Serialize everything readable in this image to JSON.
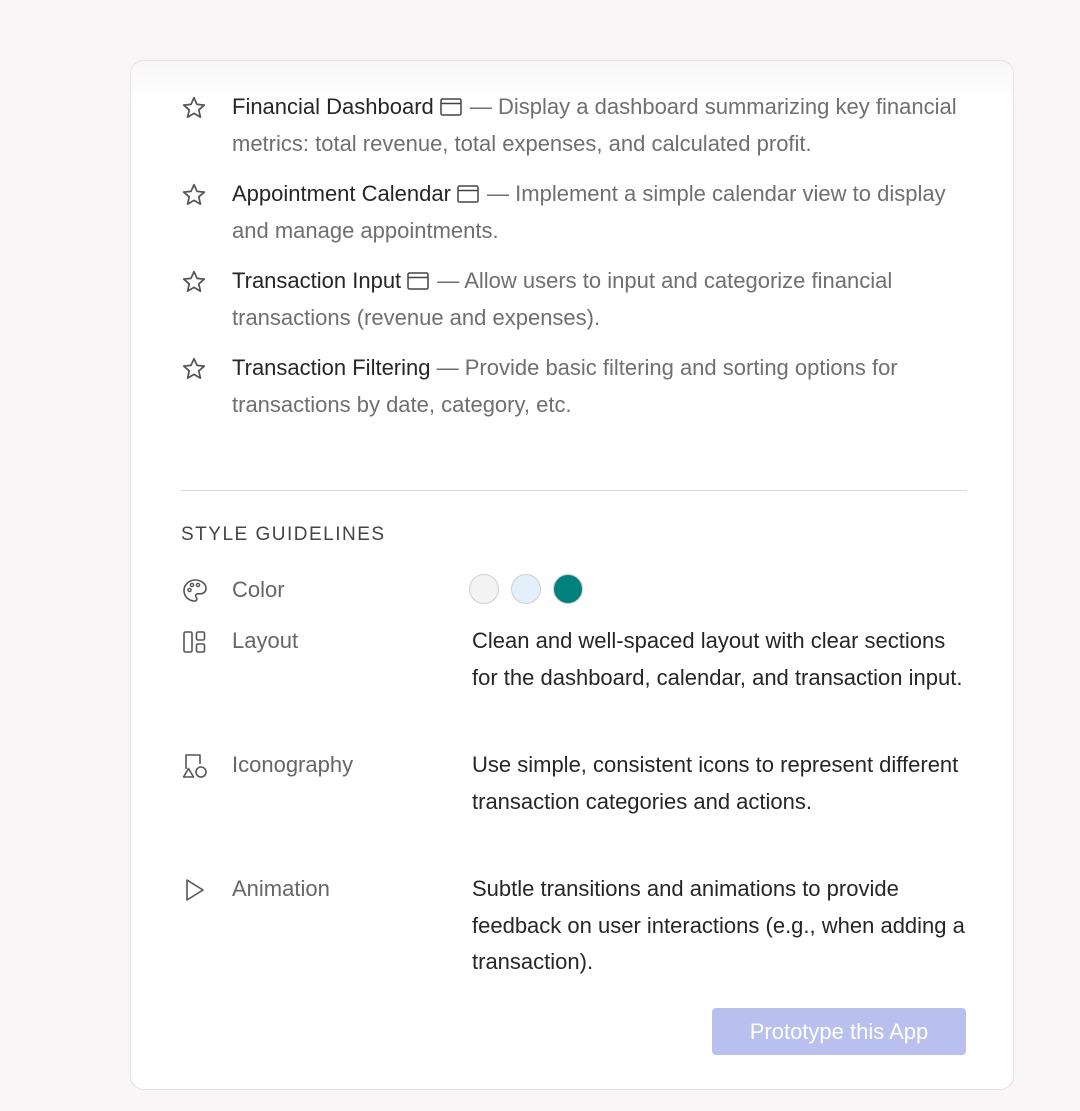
{
  "features": [
    {
      "name": "Financial Dashboard",
      "has_window_icon": true,
      "separator": "—",
      "description": "Display a dashboard summarizing key financial metrics: total revenue, total expenses, and calculated profit."
    },
    {
      "name": "Appointment Calendar",
      "has_window_icon": true,
      "separator": "—",
      "description": "Implement a simple calendar view to display and manage appointments."
    },
    {
      "name": "Transaction Input",
      "has_window_icon": true,
      "separator": "—",
      "description": "Allow users to input and categorize financial transactions (revenue and expenses)."
    },
    {
      "name": "Transaction Filtering",
      "has_window_icon": false,
      "separator": "—",
      "description": "Provide basic filtering and sorting options for transactions by date, category, etc."
    }
  ],
  "style_guidelines": {
    "title": "STYLE GUIDELINES",
    "color": {
      "label": "Color",
      "icon": "palette-icon",
      "swatches": [
        "#f3f3f3",
        "#e3f0fb",
        "#00817e"
      ]
    },
    "layout": {
      "label": "Layout",
      "icon": "layout-icon",
      "description": "Clean and well-spaced layout with clear sections for the dashboard, calendar, and transaction input."
    },
    "iconography": {
      "label": "Iconography",
      "icon": "shapes-icon",
      "description": "Use simple, consistent icons to represent different transaction categories and actions."
    },
    "animation": {
      "label": "Animation",
      "icon": "play-icon",
      "description": "Subtle transitions and animations to provide feedback on user interactions (e.g., when adding a transaction)."
    }
  },
  "prototype_button": {
    "label": "Prototype this App",
    "color": "#b9c0ee"
  }
}
